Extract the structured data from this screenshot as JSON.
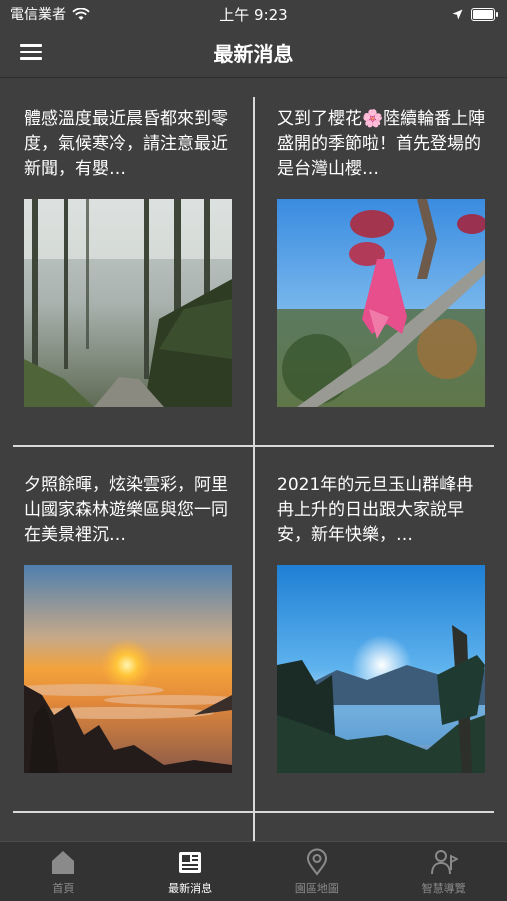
{
  "status_bar": {
    "carrier": "電信業者",
    "time": "上午 9:23"
  },
  "header": {
    "title": "最新消息"
  },
  "news": [
    {
      "text": "體感溫度最近晨昏都來到零度，氣候寒冷，請注意最近新聞，有嬰…",
      "image": "misty-forest-path"
    },
    {
      "text": "又到了櫻花🌸陸續輪番上陣盛開的季節啦！首先登場的是台灣山櫻…",
      "image": "cherry-blossom"
    },
    {
      "text": "夕照餘暉，炫染雲彩，阿里山國家森林遊樂區與您一同在美景裡沉…",
      "image": "sunset-sea-of-clouds"
    },
    {
      "text": "2021年的元旦玉山群峰冉冉上升的日出跟大家說早安，新年快樂，…",
      "image": "sunrise-mountains"
    }
  ],
  "tabs": [
    {
      "label": "首頁",
      "icon": "home-icon",
      "active": false
    },
    {
      "label": "最新消息",
      "icon": "newspaper-icon",
      "active": true
    },
    {
      "label": "園區地圖",
      "icon": "map-pin-icon",
      "active": false
    },
    {
      "label": "智慧導覽",
      "icon": "guide-person-icon",
      "active": false
    }
  ]
}
